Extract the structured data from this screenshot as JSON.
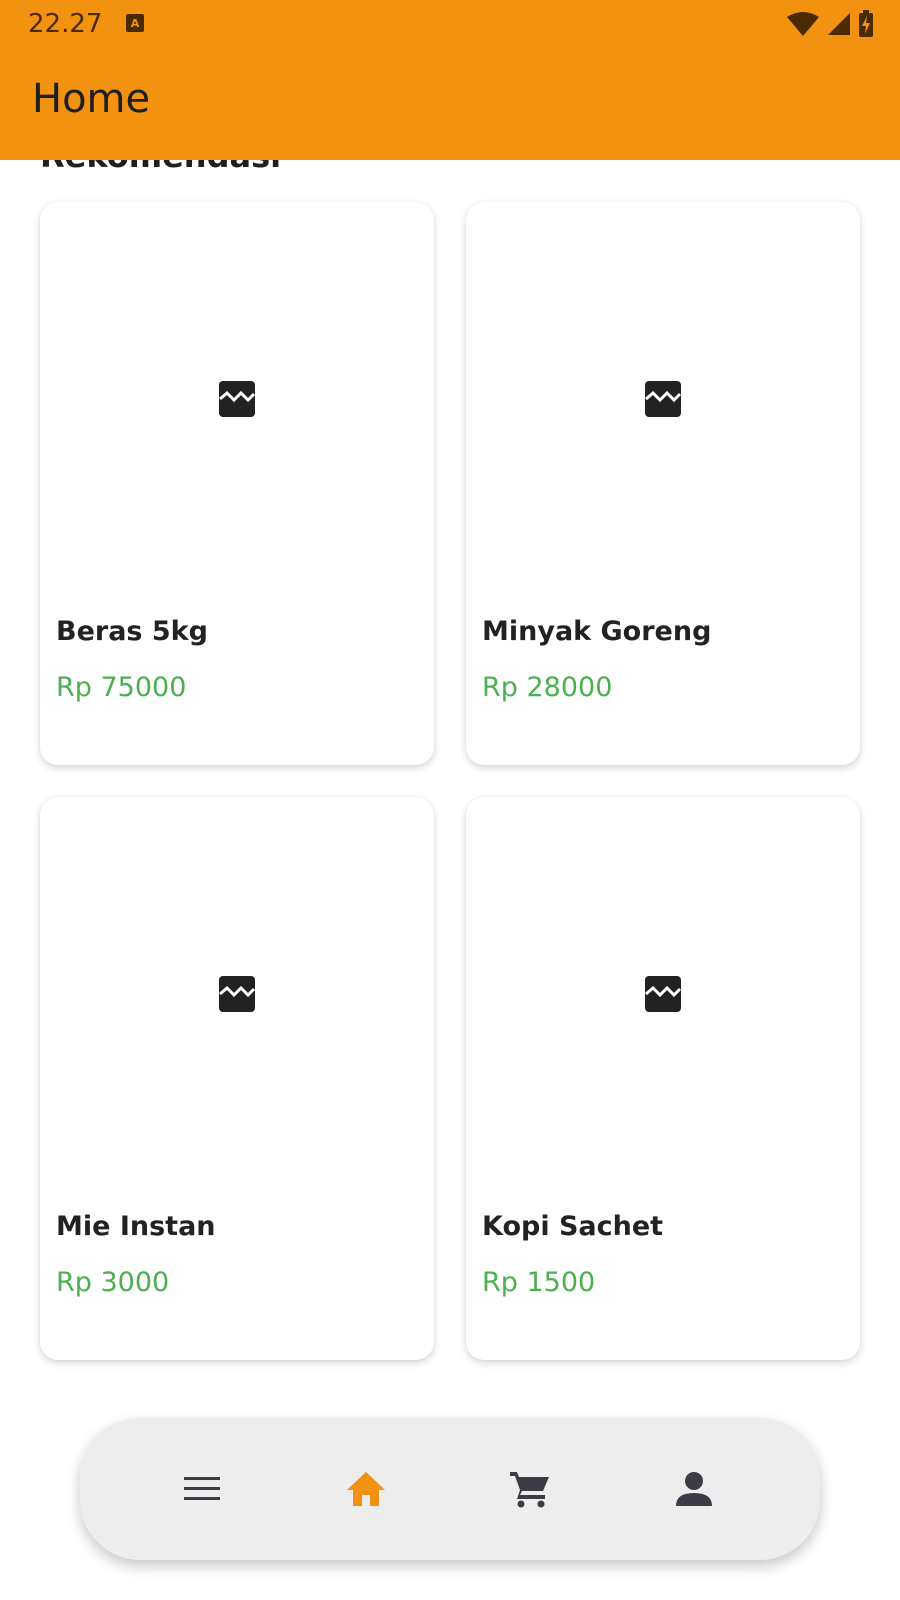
{
  "status_bar": {
    "time": "22.27",
    "icons": [
      "a-notification-icon",
      "wifi-icon",
      "cell-signal-icon",
      "battery-charging-icon"
    ]
  },
  "app_bar": {
    "title": "Home",
    "color": "#f39110"
  },
  "section": {
    "title": "Rekomendasi"
  },
  "products": [
    {
      "name": "Beras 5kg",
      "price": "Rp 75000",
      "image_icon": "broken-image-icon"
    },
    {
      "name": "Minyak Goreng",
      "price": "Rp 28000",
      "image_icon": "broken-image-icon"
    },
    {
      "name": "Mie Instan",
      "price": "Rp 3000",
      "image_icon": "broken-image-icon"
    },
    {
      "name": "Kopi Sachet",
      "price": "Rp 1500",
      "image_icon": "broken-image-icon"
    }
  ],
  "price_color": "#4caf50",
  "bottom_nav": {
    "items": [
      {
        "icon": "menu-icon",
        "active": false
      },
      {
        "icon": "home-icon",
        "active": true
      },
      {
        "icon": "cart-icon",
        "active": false
      },
      {
        "icon": "profile-icon",
        "active": false
      }
    ],
    "active_color": "#f39110",
    "inactive_color": "#3c3c46"
  }
}
